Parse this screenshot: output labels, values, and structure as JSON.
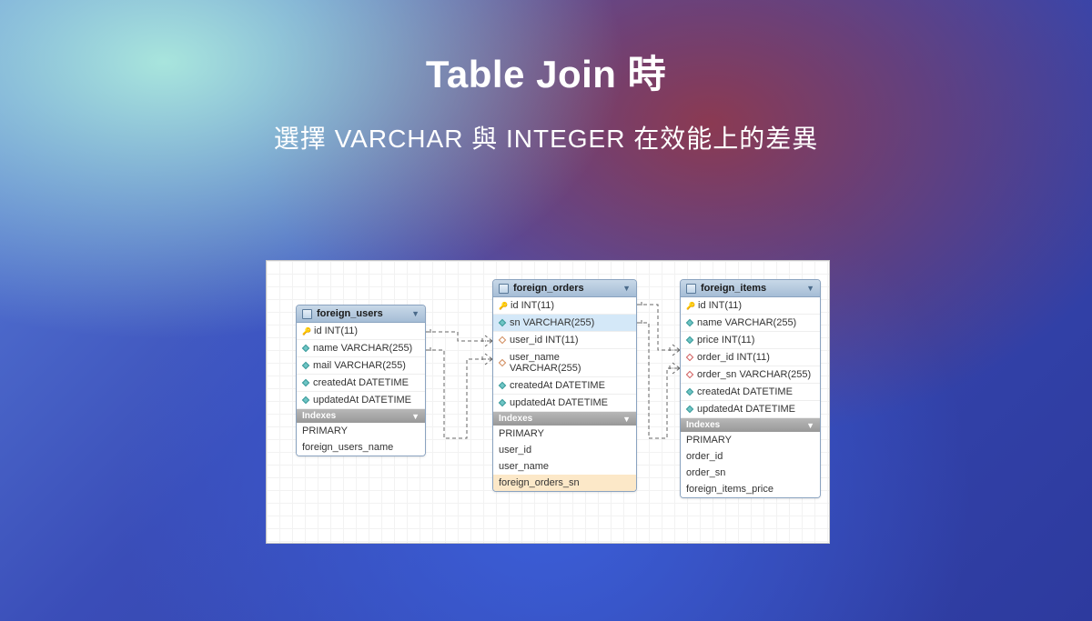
{
  "title": "Table Join 時",
  "subtitle": "選擇 VARCHAR 與 INTEGER 在效能上的差異",
  "section_label": "Indexes",
  "tables": {
    "users": {
      "name": "foreign_users",
      "columns": [
        {
          "icon": "key",
          "label": "id INT(11)"
        },
        {
          "icon": "filled",
          "label": "name VARCHAR(255)"
        },
        {
          "icon": "filled",
          "label": "mail VARCHAR(255)"
        },
        {
          "icon": "filled",
          "label": "createdAt DATETIME"
        },
        {
          "icon": "filled",
          "label": "updatedAt DATETIME"
        }
      ],
      "indexes": [
        "PRIMARY",
        "foreign_users_name"
      ]
    },
    "orders": {
      "name": "foreign_orders",
      "columns": [
        {
          "icon": "key",
          "label": "id INT(11)"
        },
        {
          "icon": "filled",
          "label": "sn VARCHAR(255)",
          "hl": "blue"
        },
        {
          "icon": "empty",
          "label": "user_id INT(11)"
        },
        {
          "icon": "empty",
          "label": "user_name VARCHAR(255)"
        },
        {
          "icon": "filled",
          "label": "createdAt DATETIME"
        },
        {
          "icon": "filled",
          "label": "updatedAt DATETIME"
        }
      ],
      "indexes": [
        "PRIMARY",
        "user_id",
        "user_name",
        "foreign_orders_sn"
      ],
      "index_hl": {
        "3": "orange"
      }
    },
    "items": {
      "name": "foreign_items",
      "columns": [
        {
          "icon": "key",
          "label": "id INT(11)"
        },
        {
          "icon": "filled",
          "label": "name VARCHAR(255)"
        },
        {
          "icon": "filled",
          "label": "price INT(11)"
        },
        {
          "icon": "red",
          "label": "order_id INT(11)"
        },
        {
          "icon": "red",
          "label": "order_sn VARCHAR(255)"
        },
        {
          "icon": "filled",
          "label": "createdAt DATETIME"
        },
        {
          "icon": "filled",
          "label": "updatedAt DATETIME"
        }
      ],
      "indexes": [
        "PRIMARY",
        "order_id",
        "order_sn",
        "foreign_items_price"
      ]
    }
  }
}
